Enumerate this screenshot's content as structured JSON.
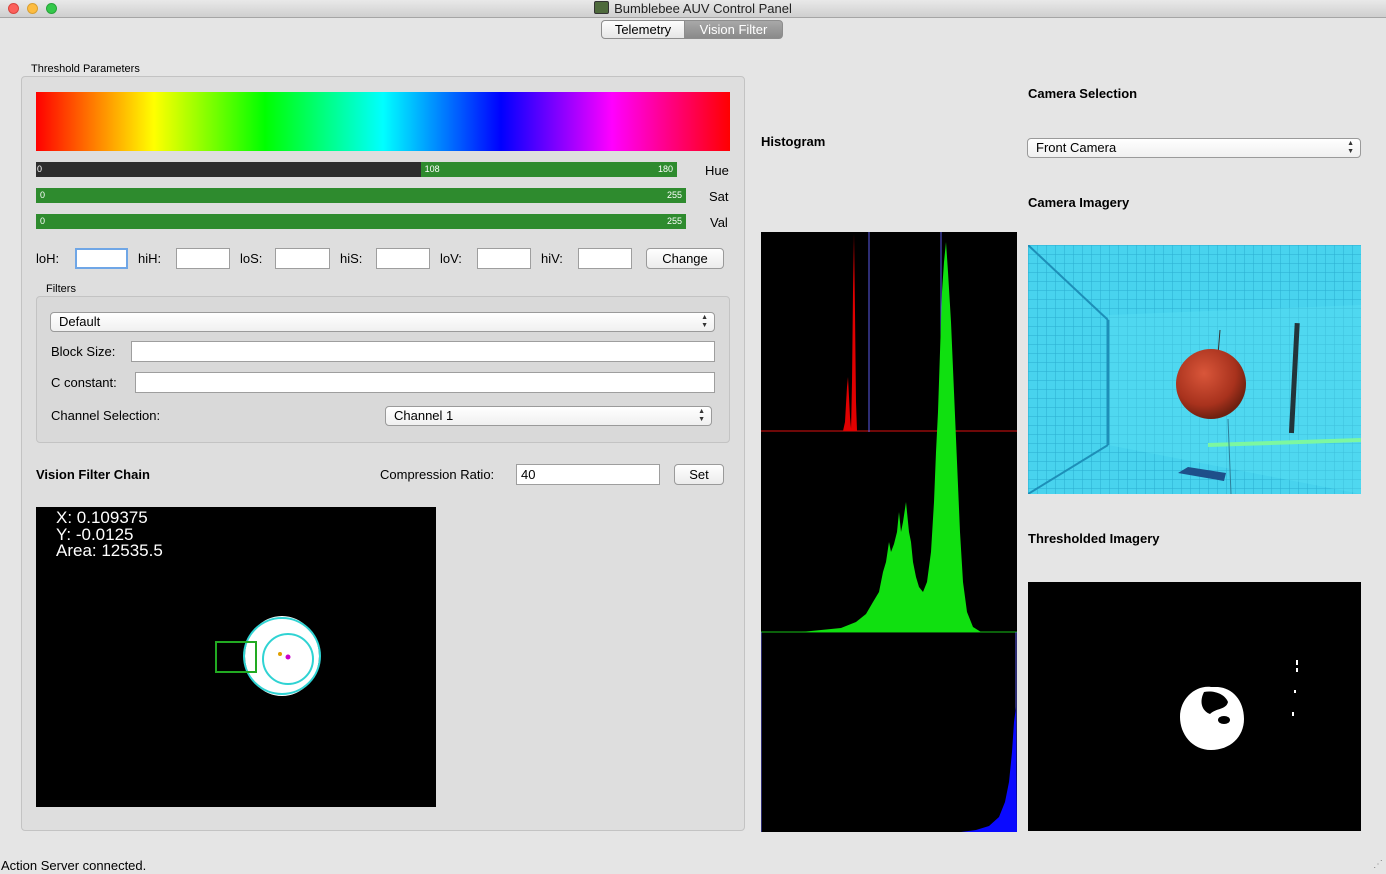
{
  "window": {
    "title": "Bumblebee AUV Control Panel"
  },
  "tabs": [
    {
      "label": "Telemetry"
    },
    {
      "label": "Vision Filter"
    }
  ],
  "threshold": {
    "group_title": "Threshold Parameters",
    "hue": {
      "label": "Hue",
      "low": 108,
      "high": 180,
      "min_label": "0",
      "low_label": "108",
      "high_label": "180",
      "max": 180
    },
    "sat": {
      "label": "Sat",
      "low": 0,
      "high": 255,
      "low_label": "0",
      "high_label": "255",
      "max": 255
    },
    "val": {
      "label": "Val",
      "low": 0,
      "high": 255,
      "low_label": "0",
      "high_label": "255",
      "max": 255
    },
    "inputs": {
      "loH_label": "loH:",
      "hiH_label": "hiH:",
      "loS_label": "loS:",
      "hiS_label": "hiS:",
      "loV_label": "loV:",
      "hiV_label": "hiV:",
      "loH": "",
      "hiH": "",
      "loS": "",
      "hiS": "",
      "loV": "",
      "hiV": ""
    },
    "change_label": "Change"
  },
  "filters": {
    "group_title": "Filters",
    "selected": "Default",
    "block_size_label": "Block Size:",
    "block_size": "",
    "c_constant_label": "C constant:",
    "c_constant": "",
    "channel_label": "Channel Selection:",
    "channel": "Channel 1"
  },
  "vision_chain": {
    "title": "Vision Filter Chain",
    "compression_label": "Compression Ratio:",
    "compression": "40",
    "set_label": "Set",
    "overlay": {
      "x_text": "X: 0.109375",
      "y_text": "Y: -0.0125",
      "area_text": "Area: 12535.5"
    }
  },
  "histogram": {
    "title": "Histogram"
  },
  "camera": {
    "selection_title": "Camera Selection",
    "selected": "Front Camera",
    "imagery_title": "Camera Imagery",
    "thresholded_title": "Thresholded Imagery"
  },
  "status": {
    "text": "Action Server connected."
  },
  "colors": {
    "bar_green": "#2e8b2e",
    "tab_selected": "#8f8f8f"
  }
}
